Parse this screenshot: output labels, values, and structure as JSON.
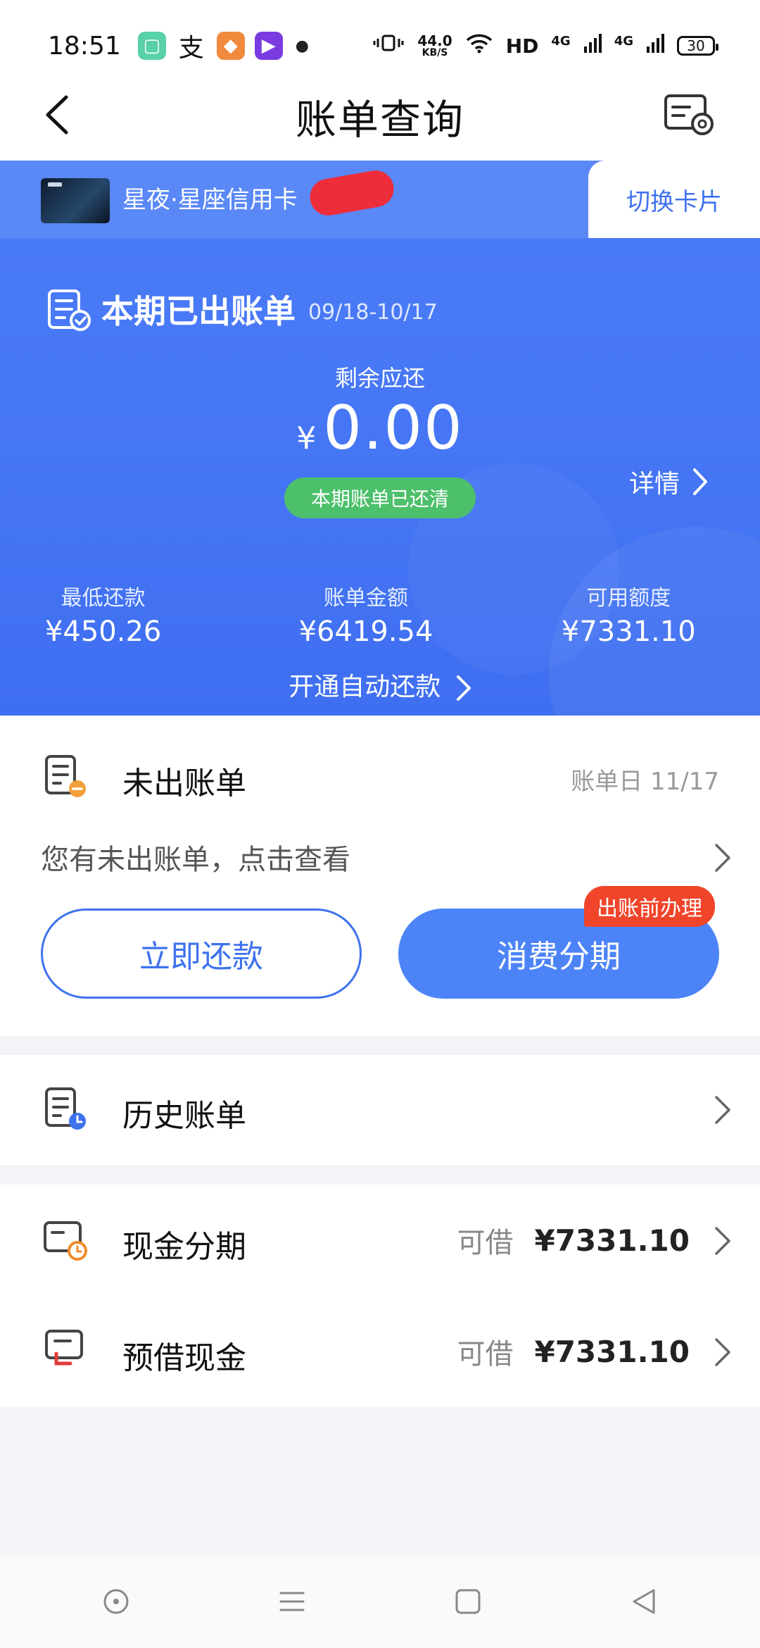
{
  "status_bar": {
    "time": "18:51",
    "net_speed": "44.0",
    "net_unit": "KB/S",
    "hd": "HD",
    "sig1": "4G",
    "sig2": "4G",
    "battery": "30",
    "icons": [
      "app-green-icon",
      "alipay-icon",
      "app-orange-icon",
      "app-purple-icon",
      "dot-icon",
      "vibrate-icon",
      "wifi-icon",
      "signal-icon",
      "battery-icon"
    ]
  },
  "nav": {
    "title": "账单查询",
    "icons": [
      "back-icon",
      "bill-settings-icon"
    ]
  },
  "card": {
    "name": "星夜·星座信用卡",
    "switch_label": "切换卡片"
  },
  "bill": {
    "title": "本期已出账单",
    "range": "09/18-10/17",
    "remain_label": "剩余应还",
    "currency": "¥",
    "amount": "0.00",
    "status_badge": "本期账单已还清",
    "detail_label": "详情",
    "stats": [
      {
        "label": "最低还款",
        "value": "¥450.26"
      },
      {
        "label": "账单金额",
        "value": "¥6419.54"
      },
      {
        "label": "可用额度",
        "value": "¥7331.10"
      }
    ],
    "autopay_label": "开通自动还款"
  },
  "unbilled": {
    "title": "未出账单",
    "date_label": "账单日 11/17",
    "hint": "您有未出账单，点击查看",
    "repay_button": "立即还款",
    "install_button": "消费分期",
    "install_badge": "出账前办理"
  },
  "history": {
    "title": "历史账单"
  },
  "cash": {
    "items": [
      {
        "title": "现金分期",
        "avail_label": "可借",
        "avail_value": "¥7331.10"
      },
      {
        "title": "预借现金",
        "avail_label": "可借",
        "avail_value": "¥7331.10"
      }
    ]
  },
  "colors": {
    "accent_blue": "#4c7df8",
    "success_green": "#4cc06a",
    "badge_red": "#f0452a"
  }
}
